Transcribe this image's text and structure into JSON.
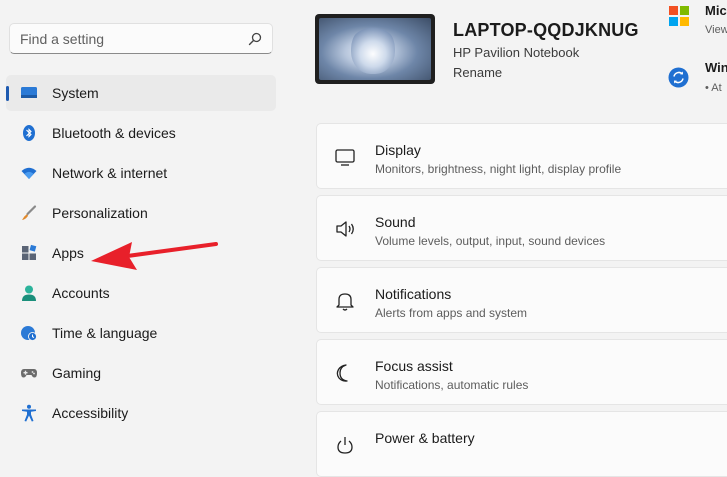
{
  "search": {
    "placeholder": "Find a setting",
    "icon": "search-icon"
  },
  "device": {
    "name": "LAPTOP-QQDJKNUG",
    "model": "HP Pavilion Notebook",
    "rename_label": "Rename"
  },
  "top_right": {
    "microsoft_title": "Mic",
    "microsoft_sub": "View",
    "update_title": "Win",
    "update_sub": "• At"
  },
  "sidebar": {
    "items": [
      {
        "label": "System",
        "icon": "system-icon",
        "selected": true
      },
      {
        "label": "Bluetooth & devices",
        "icon": "bluetooth-icon"
      },
      {
        "label": "Network & internet",
        "icon": "wifi-icon"
      },
      {
        "label": "Personalization",
        "icon": "brush-icon"
      },
      {
        "label": "Apps",
        "icon": "apps-icon"
      },
      {
        "label": "Accounts",
        "icon": "accounts-icon"
      },
      {
        "label": "Time & language",
        "icon": "globe-clock-icon"
      },
      {
        "label": "Gaming",
        "icon": "gamepad-icon"
      },
      {
        "label": "Accessibility",
        "icon": "accessibility-icon"
      }
    ]
  },
  "cards": [
    {
      "title": "Display",
      "subtitle": "Monitors, brightness, night light, display profile",
      "icon": "display-icon"
    },
    {
      "title": "Sound",
      "subtitle": "Volume levels, output, input, sound devices",
      "icon": "speaker-icon"
    },
    {
      "title": "Notifications",
      "subtitle": "Alerts from apps and system",
      "icon": "bell-icon"
    },
    {
      "title": "Focus assist",
      "subtitle": "Notifications, automatic rules",
      "icon": "moon-icon"
    },
    {
      "title": "Power & battery",
      "subtitle": "",
      "icon": "power-icon"
    }
  ],
  "colors": {
    "accent": "#1e5ab0",
    "annotation_arrow": "#e8202a",
    "background": "#f3f3f3"
  }
}
